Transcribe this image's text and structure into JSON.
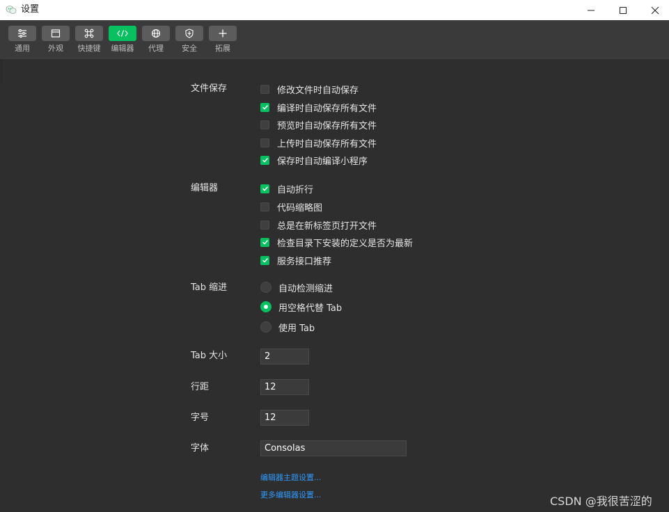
{
  "window": {
    "title": "设置",
    "controls": {
      "minimize": "minimize-icon",
      "maximize": "maximize-icon",
      "close": "close-icon"
    }
  },
  "toolbar": {
    "accent_color": "#07c160",
    "items": [
      {
        "label": "通用",
        "icon": "sliders-icon",
        "active": false
      },
      {
        "label": "外观",
        "icon": "window-icon",
        "active": false
      },
      {
        "label": "快捷键",
        "icon": "command-icon",
        "active": false
      },
      {
        "label": "编辑器",
        "icon": "code-icon",
        "active": true
      },
      {
        "label": "代理",
        "icon": "globe-icon",
        "active": false
      },
      {
        "label": "安全",
        "icon": "shield-icon",
        "active": false
      },
      {
        "label": "拓展",
        "icon": "plus-icon",
        "active": false
      }
    ]
  },
  "file_save": {
    "label": "文件保存",
    "options": [
      {
        "label": "修改文件时自动保存",
        "checked": false
      },
      {
        "label": "编译时自动保存所有文件",
        "checked": true
      },
      {
        "label": "预览时自动保存所有文件",
        "checked": false
      },
      {
        "label": "上传时自动保存所有文件",
        "checked": false
      },
      {
        "label": "保存时自动编译小程序",
        "checked": true
      }
    ]
  },
  "editor": {
    "label": "编辑器",
    "options": [
      {
        "label": "自动折行",
        "checked": true
      },
      {
        "label": "代码缩略图",
        "checked": false
      },
      {
        "label": "总是在新标签页打开文件",
        "checked": false
      },
      {
        "label": "检查目录下安装的定义是否为最新",
        "checked": true
      },
      {
        "label": "服务接口推荐",
        "checked": true
      }
    ]
  },
  "tab_indent": {
    "label": "Tab 缩进",
    "options": [
      {
        "label": "自动检测缩进",
        "selected": false
      },
      {
        "label": "用空格代替 Tab",
        "selected": true
      },
      {
        "label": "使用 Tab",
        "selected": false
      }
    ]
  },
  "fields": {
    "tab_size": {
      "label": "Tab 大小",
      "value": "2"
    },
    "line_height": {
      "label": "行距",
      "value": "12"
    },
    "font_size": {
      "label": "字号",
      "value": "12"
    },
    "font_family": {
      "label": "字体",
      "value": "Consolas"
    }
  },
  "links": {
    "theme": "编辑器主题设置...",
    "more": "更多编辑器设置..."
  },
  "watermark": "CSDN @我很苦涩的"
}
